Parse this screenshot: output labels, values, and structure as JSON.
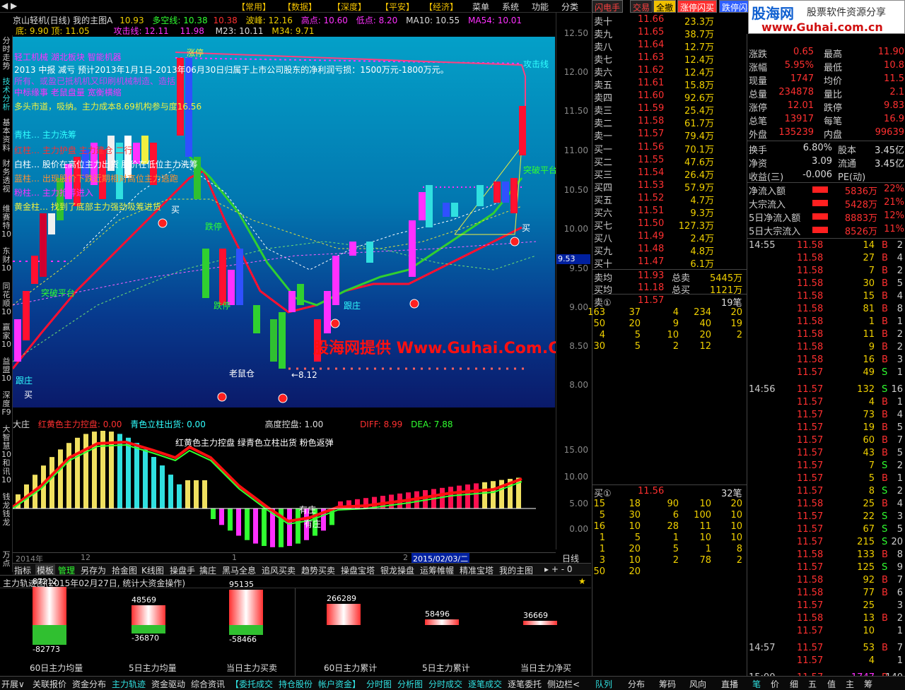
{
  "menubar": {
    "items": [
      "【常用】",
      "【数据】",
      "【深度】",
      "【平安】",
      "【经济】",
      "菜单",
      "系统",
      "功能",
      "分类"
    ],
    "right_tabs": [
      "闪电手",
      "交易",
      "全撤",
      "涨停闪买",
      "跌停闪卖"
    ]
  },
  "chart_header": {
    "line1": "京山轻机(日线) 我的主图A",
    "val1": "10.93",
    "duo": "多空线: 10.38",
    "duo2": "10.38",
    "bo": "波峰: 12.16",
    "gao": "高点: 10.60",
    "di": "低点: 8.20",
    "ma10": "MA10: 10.55",
    "ma54": "MA54: 10.01",
    "line2a": "底: 9.90 顶: 11.05",
    "gong": "攻击线: 12.11",
    "gong2": "11.98",
    "m23": "M23: 10.11",
    "m34": "M34: 9.71"
  },
  "left_strip": [
    "分时走势",
    "技术分析",
    "基本资料",
    "财务透视",
    "维赛特10",
    "东财10",
    "同花顺10",
    "赢家10",
    "益盟10",
    "深度F9",
    "大智慧10",
    "和讯10",
    "钱龙",
    "钱龙",
    "万点"
  ],
  "overlay": {
    "sector": "轻工机械 湖北板块 智能机器",
    "notice": "2013 中报 减亏 预计2013年1月1日-2013年06月30日归属于上市公司股东的净利润亏损：1500万元-1800万元。",
    "l2": "所有、或盈已抵机机又印刷机械制造、造括",
    "l3": "中标缘事 老鼠盘量 宽衡横缩",
    "trend": "多头市道，吸纳。主力成本8.69机构参与度16.56",
    "q1": "青柱… 主力洗筹",
    "q2": "红柱… 主力护盘 主力建仓 二行",
    "q3": "白柱… 股价在高位主力出货 股价在低位主力洗筹",
    "q4": "蓝柱… 出现股价下跌近期相对高位主力逃跑",
    "q5": "粉柱… 主力抢筹进入",
    "q6": "黄金柱… 找到了底部主力强劲吸筹进货",
    "gongjixian": "攻击线",
    "tupo": "突破平台",
    "tupo2": "突破平台",
    "zhangting": "涨停",
    "dieting": "跌停",
    "dieting2": "跌停",
    "genzhuang1": "跟庄",
    "genzhuang2": "跟庄",
    "laoshucang": "老鼠仓",
    "low_label": "←8.12",
    "watermark": "股海网提供 Www.Guhai.Com.CN",
    "buy": "买",
    "price_tag": "9.53"
  },
  "yaxis": [
    "12.50",
    "12.00",
    "11.50",
    "11.00",
    "10.50",
    "10.00",
    "9.50",
    "9.00",
    "8.50",
    "8.00"
  ],
  "sub_header": {
    "name": "大庄",
    "red": "红黄色主力控盘: 0.00",
    "cyan": "青色立柱出货: 0.00",
    "gd": "高度控盘: 1.00",
    "diff": "DIFF: 8.99",
    "dea": "DEA: 7.88",
    "legend": "红黄色主力控盘 绿青色立柱出货 粉色返弹",
    "youzhuang": "有庄",
    "wuzhuang": "有庄"
  },
  "sub_yaxis": [
    "15.00",
    "10.00",
    "5.00",
    "0.00"
  ],
  "xaxis": {
    "y2014": "2014年",
    "m12": "12",
    "m1": "1",
    "m2": "2",
    "date": "2015/02/03/二",
    "period": "日线"
  },
  "bottom_tabs": [
    "指标",
    "模板",
    "管理",
    "另存为",
    "拾金图",
    "K线图",
    "操盘手",
    "擒庄",
    "黑马全息",
    "追风买卖",
    "趋势买卖",
    "操盘宝塔",
    "银龙操盘",
    "运筹帷幄",
    "精准宝塔",
    "我的主图"
  ],
  "bottom_title": "主力轨迹图(2015年02月27日, 统计大资金操作)",
  "bottom_bars": [
    {
      "top": "87212",
      "bottom": "-82773",
      "label": "60日主力均量"
    },
    {
      "top": "48569",
      "bottom": "-36870",
      "label": "5日主力均量"
    },
    {
      "top": "95135",
      "bottom": "-58466",
      "label": "当日主力买卖"
    },
    {
      "top": "266289",
      "label": "60日主力累计"
    },
    {
      "top": "58496",
      "label": "5日主力累计"
    },
    {
      "top": "36669",
      "label": "当日主力净买"
    }
  ],
  "orderbook": {
    "sell": [
      [
        "卖十",
        "11.66",
        "23.3万"
      ],
      [
        "卖九",
        "11.65",
        "38.7万"
      ],
      [
        "卖八",
        "11.64",
        "12.7万"
      ],
      [
        "卖七",
        "11.63",
        "12.4万"
      ],
      [
        "卖六",
        "11.62",
        "12.4万"
      ],
      [
        "卖五",
        "11.61",
        "15.8万"
      ],
      [
        "卖四",
        "11.60",
        "92.6万"
      ],
      [
        "卖三",
        "11.59",
        "25.4万"
      ],
      [
        "卖二",
        "11.58",
        "61.7万"
      ],
      [
        "卖一",
        "11.57",
        "79.4万"
      ]
    ],
    "buy": [
      [
        "买一",
        "11.56",
        "70.1万"
      ],
      [
        "买二",
        "11.55",
        "47.6万"
      ],
      [
        "买三",
        "11.54",
        "26.4万"
      ],
      [
        "买四",
        "11.53",
        "57.9万"
      ],
      [
        "买五",
        "11.52",
        "4.7万"
      ],
      [
        "买六",
        "11.51",
        "9.3万"
      ],
      [
        "买七",
        "11.50",
        "127.3万"
      ],
      [
        "买八",
        "11.49",
        "2.4万"
      ],
      [
        "买九",
        "11.48",
        "4.8万"
      ],
      [
        "买十",
        "11.47",
        "6.1万"
      ]
    ],
    "maijun": "卖均",
    "maijun_p": "11.93",
    "zongmai": "总卖",
    "zongmai_v": "5445万",
    "mairjun": "买均",
    "mairjun_p": "11.18",
    "zongmair": "总买",
    "zongmair_v": "1121万",
    "sell1": "卖①",
    "sell1_p": "11.57",
    "sell1_n": "19笔",
    "sell_queue": [
      [
        "163",
        "37",
        "4",
        "234",
        "20"
      ],
      [
        "50",
        "20",
        "9",
        "40",
        "19"
      ],
      [
        "4",
        "5",
        "10",
        "20",
        "2"
      ],
      [
        "30",
        "5",
        "2",
        "12",
        ""
      ]
    ],
    "buy1": "买①",
    "buy1_p": "11.56",
    "buy1_n": "32笔",
    "buy_queue": [
      [
        "15",
        "18",
        "90",
        "10",
        "20"
      ],
      [
        "5",
        "30",
        "6",
        "100",
        "10"
      ],
      [
        "16",
        "10",
        "28",
        "11",
        "10"
      ],
      [
        "1",
        "5",
        "1",
        "10",
        "10"
      ],
      [
        "1",
        "20",
        "5",
        "1",
        "8"
      ],
      [
        "3",
        "10",
        "2",
        "78",
        "2"
      ],
      [
        "50",
        "20",
        "",
        "",
        ""
      ]
    ]
  },
  "logo": {
    "brand": "股海网",
    "tag": "股票软件资源分享",
    "url": "www.Guhai.com.cn"
  },
  "quote": [
    [
      "涨跌",
      "0.65",
      "最高",
      "11.90"
    ],
    [
      "涨幅",
      "5.95%",
      "最低",
      "10.8"
    ],
    [
      "现量",
      "1747",
      "均价",
      "11.5"
    ],
    [
      "总量",
      "234878",
      "量比",
      "2.1"
    ],
    [
      "涨停",
      "12.01",
      "跌停",
      "9.83"
    ],
    [
      "总笔",
      "13917",
      "每笔",
      "16.9"
    ],
    [
      "外盘",
      "135239",
      "内盘",
      "99639"
    ]
  ],
  "quote2": [
    [
      "换手",
      "6.80%",
      "股本",
      "3.45亿"
    ],
    [
      "净资",
      "3.09",
      "流通",
      "3.45亿"
    ],
    [
      "收益(三)",
      "-0.006",
      "PE(动)",
      ""
    ]
  ],
  "flow": [
    [
      "净流入额",
      "5836万",
      "22%"
    ],
    [
      "大宗流入",
      "5428万",
      "21%"
    ],
    [
      "5日净流入额",
      "8883万",
      "12%"
    ],
    [
      "5日大宗流入",
      "8526万",
      "11%"
    ]
  ],
  "trades": [
    [
      "14:55",
      "11.58",
      "14",
      "B",
      "2"
    ],
    [
      "",
      "11.58",
      "27",
      "B",
      "4"
    ],
    [
      "",
      "11.58",
      "7",
      "B",
      "2"
    ],
    [
      "",
      "11.58",
      "30",
      "B",
      "5"
    ],
    [
      "",
      "11.58",
      "15",
      "B",
      "4"
    ],
    [
      "",
      "11.58",
      "81",
      "B",
      "8"
    ],
    [
      "",
      "11.58",
      "1",
      "B",
      "1"
    ],
    [
      "",
      "11.58",
      "11",
      "B",
      "2"
    ],
    [
      "",
      "11.58",
      "9",
      "B",
      "2"
    ],
    [
      "",
      "11.58",
      "16",
      "B",
      "3"
    ],
    [
      "",
      "11.57",
      "49",
      "S",
      "1"
    ],
    [
      "14:56",
      "11.57",
      "132",
      "S",
      "16"
    ],
    [
      "",
      "11.57",
      "4",
      "B",
      "1"
    ],
    [
      "",
      "11.57",
      "73",
      "B",
      "4"
    ],
    [
      "",
      "11.57",
      "19",
      "B",
      "5"
    ],
    [
      "",
      "11.57",
      "60",
      "B",
      "7"
    ],
    [
      "",
      "11.57",
      "43",
      "B",
      "5"
    ],
    [
      "",
      "11.57",
      "7",
      "S",
      "2"
    ],
    [
      "",
      "11.57",
      "5",
      "B",
      "1"
    ],
    [
      "",
      "11.57",
      "8",
      "S",
      "2"
    ],
    [
      "",
      "11.58",
      "25",
      "B",
      "4"
    ],
    [
      "",
      "11.57",
      "22",
      "S",
      "3"
    ],
    [
      "",
      "11.57",
      "67",
      "S",
      "5"
    ],
    [
      "",
      "11.57",
      "215",
      "S",
      "20"
    ],
    [
      "",
      "11.58",
      "133",
      "B",
      "8"
    ],
    [
      "",
      "11.57",
      "125",
      "S",
      "9"
    ],
    [
      "",
      "11.58",
      "92",
      "B",
      "7"
    ],
    [
      "",
      "11.58",
      "77",
      "B",
      "6"
    ],
    [
      "",
      "11.57",
      "25",
      "",
      "3"
    ],
    [
      "",
      "11.58",
      "13",
      "B",
      "2"
    ],
    [
      "",
      "11.57",
      "10",
      "",
      "1"
    ],
    [
      "14:57",
      "11.57",
      "53",
      "B",
      "7"
    ],
    [
      "",
      "11.57",
      "4",
      "",
      "1"
    ],
    [
      "15:00",
      "11.57",
      "1747",
      "B",
      "140"
    ]
  ],
  "status_left": [
    "开展∨",
    "关联报价",
    "资金分布",
    "主力轨迹",
    "资金驱动",
    "综合资讯",
    "【委托成交",
    "持仓股份",
    "帐户资金】",
    "分时图",
    "分析图",
    "分时成交",
    "逐笔成交",
    "逐笔委托",
    "侧边栏<"
  ],
  "status_right": [
    "队列",
    "分布",
    "筹码",
    "风向",
    "直播",
    "笔",
    "价",
    "细",
    "五",
    "值",
    "主",
    "筹"
  ],
  "colors": {
    "red": "#ff3030",
    "green": "#30ff30",
    "yellow": "#f0d000",
    "cyan": "#30e0e0",
    "magenta": "#ff30ff"
  }
}
